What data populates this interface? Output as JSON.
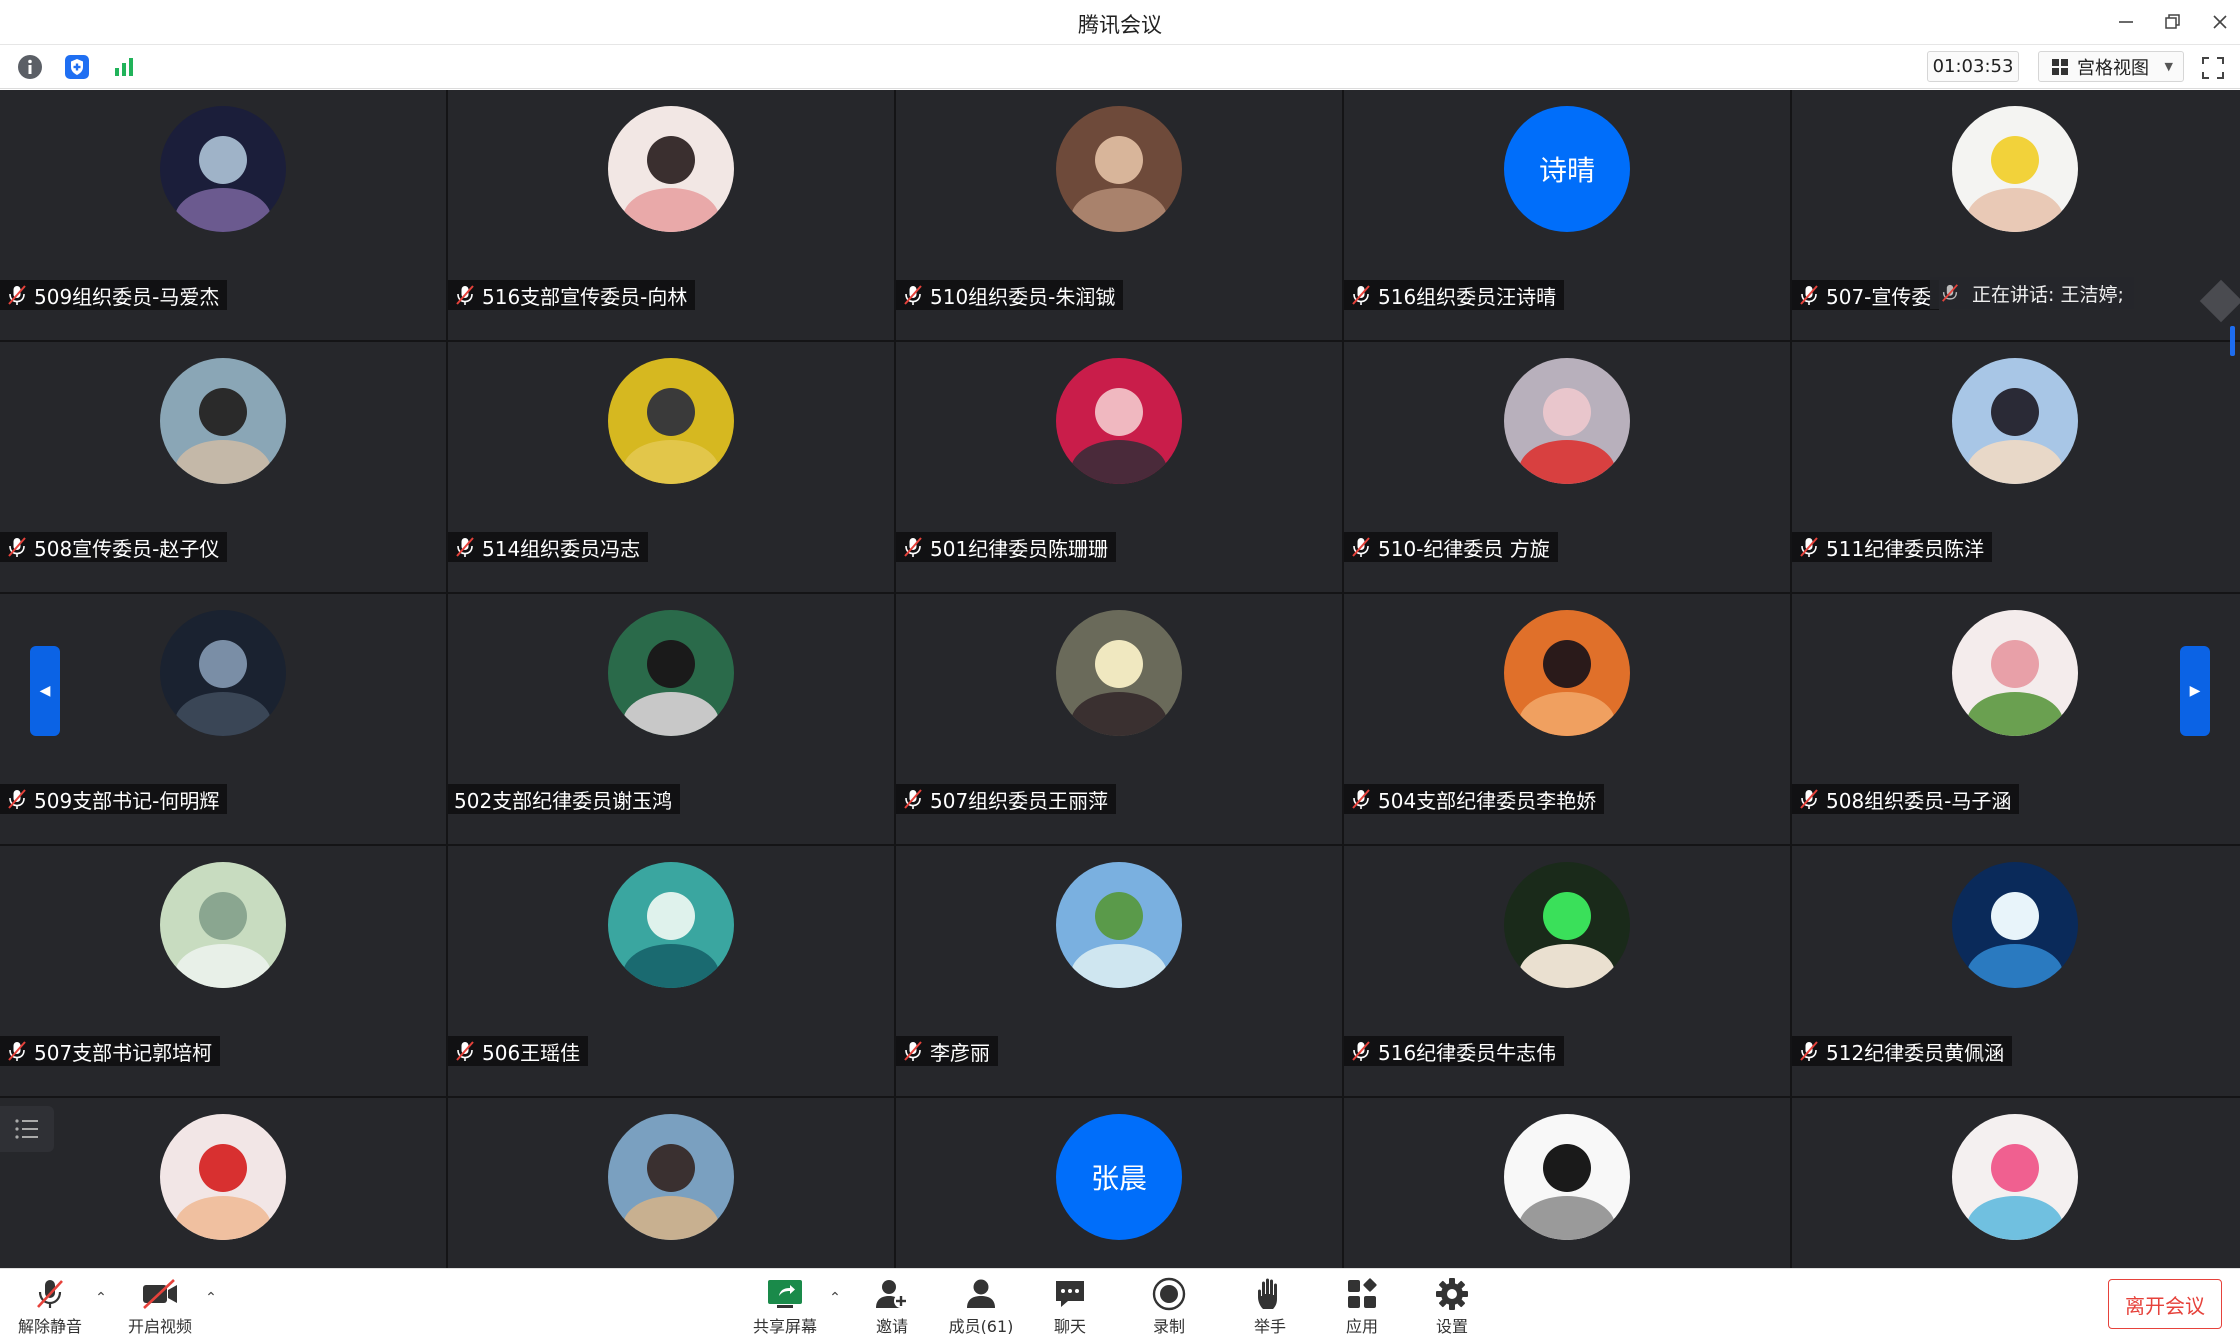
{
  "window": {
    "title": "腾讯会议"
  },
  "toolbar": {
    "timer": "01:03:53",
    "view_label": "宫格视图"
  },
  "speaking": {
    "label": "正在讲话: 王洁婷;"
  },
  "tiles": [
    {
      "name": "509组织委员-马爱杰",
      "muted": true
    },
    {
      "name": "516支部宣传委员-向林",
      "muted": true
    },
    {
      "name": "510组织委员-朱润铖",
      "muted": true
    },
    {
      "name": "516组织委员汪诗晴",
      "muted": true,
      "avatar_text": "诗晴"
    },
    {
      "name": "507-宣传委",
      "muted": true
    },
    {
      "name": "508宣传委员-赵子仪",
      "muted": true
    },
    {
      "name": "514组织委员冯志",
      "muted": true
    },
    {
      "name": "501纪律委员陈珊珊",
      "muted": true
    },
    {
      "name": "510-纪律委员 方旋",
      "muted": true
    },
    {
      "name": "511纪律委员陈洋",
      "muted": true
    },
    {
      "name": "509支部书记-何明辉",
      "muted": true
    },
    {
      "name": "502支部纪律委员谢玉鸿",
      "muted": false
    },
    {
      "name": "507组织委员王丽萍",
      "muted": true
    },
    {
      "name": "504支部纪律委员李艳娇",
      "muted": true
    },
    {
      "name": "508组织委员-马子涵",
      "muted": true
    },
    {
      "name": "507支部书记郭培柯",
      "muted": true
    },
    {
      "name": "506王瑶佳",
      "muted": true
    },
    {
      "name": "李彦丽",
      "muted": true
    },
    {
      "name": "516纪律委员牛志伟",
      "muted": true
    },
    {
      "name": "512纪律委员黄佩涵",
      "muted": true
    },
    {
      "name": "",
      "muted": false
    },
    {
      "name": "",
      "muted": false
    },
    {
      "name": "",
      "muted": false,
      "avatar_text": "张晨"
    },
    {
      "name": "",
      "muted": false
    },
    {
      "name": "",
      "muted": false
    }
  ],
  "bottombar": {
    "unmute": "解除静音",
    "start_video": "开启视频",
    "share_screen": "共享屏幕",
    "invite": "邀请",
    "members": "成员(61)",
    "chat": "聊天",
    "record": "录制",
    "raise_hand": "举手",
    "apps": "应用",
    "settings": "设置",
    "leave": "离开会议"
  },
  "icons": {
    "info": "info-icon",
    "shield": "shield-icon",
    "signal": "signal-icon",
    "grid_view": "grid-view-icon",
    "fullscreen": "fullscreen-icon",
    "mic_muted": "mic-muted-icon"
  },
  "colors": {
    "grid_bg": "#26272b",
    "accent": "#006efa",
    "leave": "#e6423b"
  }
}
